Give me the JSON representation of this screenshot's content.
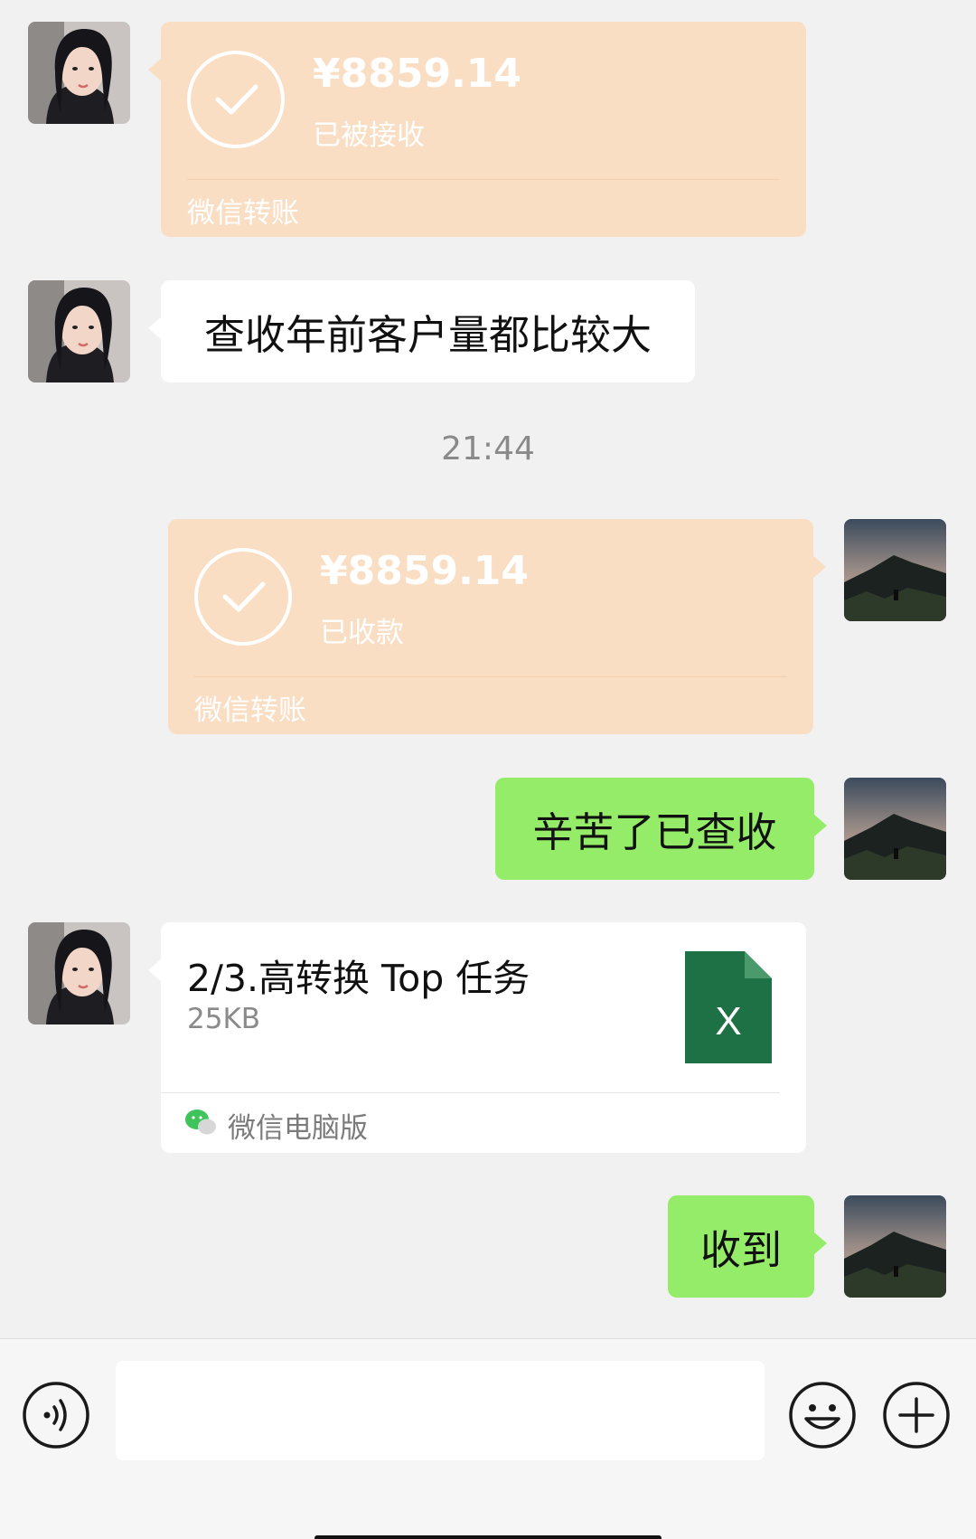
{
  "messages": {
    "transfer_1": {
      "amount": "¥8859.14",
      "status": "已被接收",
      "footer": "微信转账"
    },
    "text_1": {
      "text": "查收年前客户量都比较大"
    },
    "timestamp": "21:44",
    "transfer_2": {
      "amount": "¥8859.14",
      "status": "已收款",
      "footer": "微信转账"
    },
    "text_2": {
      "text": "辛苦了已查收"
    },
    "file_1": {
      "name": "2/3.高转换 Top 任务",
      "size": "25KB",
      "source": "微信电脑版",
      "icon": "excel-file-icon"
    },
    "text_3": {
      "text": "收到"
    }
  },
  "colors": {
    "transfer_bubble": "#fadec3",
    "sent_bubble": "#95ec69",
    "received_bubble": "#ffffff",
    "background": "#f1f1f1",
    "excel_green": "#1e7145"
  },
  "input_bar": {
    "voice_icon": "voice-icon",
    "emoji_icon": "emoji-icon",
    "plus_icon": "plus-icon"
  }
}
